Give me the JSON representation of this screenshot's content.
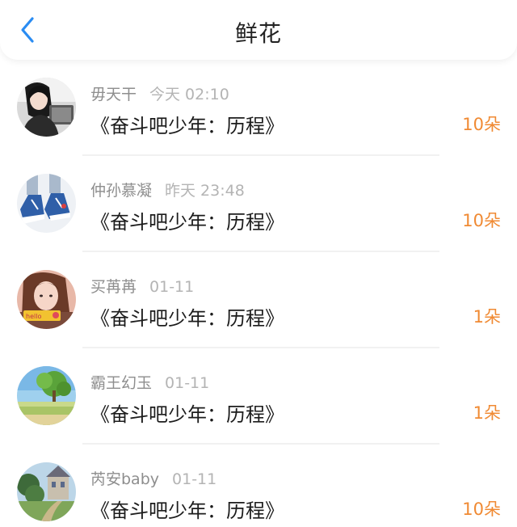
{
  "header": {
    "title": "鲜花",
    "back_icon": "chevron-left-icon",
    "accent": "#2a8cf2"
  },
  "colors": {
    "count": "#f08a33",
    "username": "#8e8e8e",
    "time": "#b4b4b4"
  },
  "items": [
    {
      "user": "毋天干",
      "time": "今天 02:10",
      "book": "《奋斗吧少年：历程》",
      "count": "10朵"
    },
    {
      "user": "仲孙慕凝",
      "time": "昨天 23:48",
      "book": "《奋斗吧少年：历程》",
      "count": "10朵"
    },
    {
      "user": "买苒苒",
      "time": "01-11",
      "book": "《奋斗吧少年：历程》",
      "count": "1朵"
    },
    {
      "user": "霸王幻玉",
      "time": "01-11",
      "book": "《奋斗吧少年：历程》",
      "count": "1朵"
    },
    {
      "user": "芮安baby",
      "time": "01-11",
      "book": "《奋斗吧少年：历程》",
      "count": "10朵"
    }
  ]
}
